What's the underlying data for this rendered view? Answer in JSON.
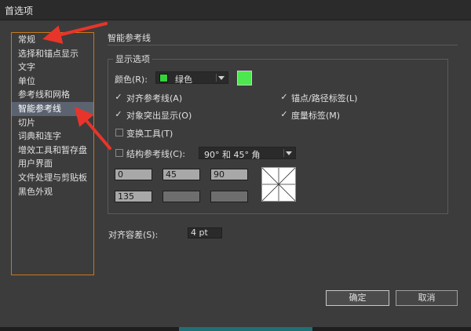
{
  "window": {
    "title": "首选项"
  },
  "sidebar": {
    "items": [
      {
        "label": "常规",
        "selected": false
      },
      {
        "label": "选择和锚点显示",
        "selected": false
      },
      {
        "label": "文字",
        "selected": false
      },
      {
        "label": "单位",
        "selected": false
      },
      {
        "label": "参考线和网格",
        "selected": false
      },
      {
        "label": "智能参考线",
        "selected": true
      },
      {
        "label": "切片",
        "selected": false
      },
      {
        "label": "词典和连字",
        "selected": false
      },
      {
        "label": "增效工具和暂存盘",
        "selected": false
      },
      {
        "label": "用户界面",
        "selected": false
      },
      {
        "label": "文件处理与剪贴板",
        "selected": false
      },
      {
        "label": "黑色外观",
        "selected": false
      }
    ]
  },
  "panel": {
    "section_title": "智能参考线",
    "display_group": "显示选项",
    "color_label": "颜色(R):",
    "color_value": "绿色",
    "color_hex": "#33d43a",
    "align_guides": {
      "label": "对齐参考线(A)",
      "checked": true
    },
    "object_highlight": {
      "label": "对象突出显示(O)",
      "checked": true
    },
    "transform_tools": {
      "label": "变换工具(T)",
      "checked": false
    },
    "anchor_labels": {
      "label": "锚点/路径标签(L)",
      "checked": true
    },
    "measure_labels": {
      "label": "度量标签(M)",
      "checked": true
    },
    "construction_guides": {
      "label": "结构参考线(C):",
      "checked": false,
      "value": "90° 和 45° 角"
    },
    "angles": [
      "0",
      "45",
      "90",
      "135",
      "",
      ""
    ],
    "tolerance_label": "对齐容差(S):",
    "tolerance_value": "4 pt"
  },
  "buttons": {
    "ok": "确定",
    "cancel": "取消"
  },
  "colors": {
    "accent_arrow": "#e8342a",
    "list_border": "#c8791b"
  }
}
